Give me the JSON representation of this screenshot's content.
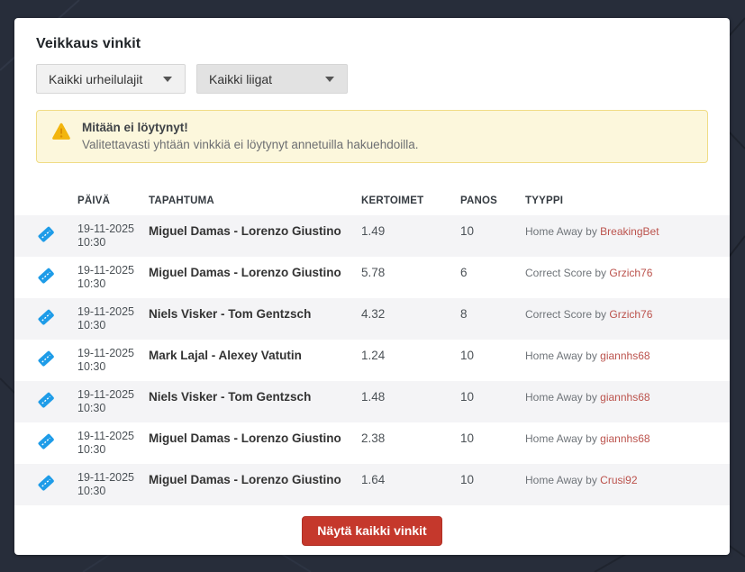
{
  "page": {
    "title": "Veikkaus vinkit"
  },
  "filters": {
    "sport": {
      "selected": "Kaikki urheilulajit"
    },
    "league": {
      "selected": "Kaikki liigat"
    }
  },
  "alert": {
    "icon": "warning-triangle-icon",
    "title": "Mitään ei löytynyt!",
    "message": "Valitettavasti yhtään vinkkiä ei löytynyt annetuilla hakuehdoilla."
  },
  "table": {
    "headers": [
      "PÄIVÄ",
      "TAPAHTUMA",
      "KERTOIMET",
      "PANOS",
      "TYYPPI"
    ],
    "row_icon": "ticket-icon",
    "rows": [
      {
        "date": "19-11-2025",
        "time": "10:30",
        "event": "Miguel Damas - Lorenzo Giustino",
        "odds": "1.49",
        "stake": "10",
        "type_prefix": "Home Away by",
        "tipster": "BreakingBet"
      },
      {
        "date": "19-11-2025",
        "time": "10:30",
        "event": "Miguel Damas - Lorenzo Giustino",
        "odds": "5.78",
        "stake": "6",
        "type_prefix": "Correct Score by",
        "tipster": "Grzich76"
      },
      {
        "date": "19-11-2025",
        "time": "10:30",
        "event": "Niels Visker - Tom Gentzsch",
        "odds": "4.32",
        "stake": "8",
        "type_prefix": "Correct Score by",
        "tipster": "Grzich76"
      },
      {
        "date": "19-11-2025",
        "time": "10:30",
        "event": "Mark Lajal - Alexey Vatutin",
        "odds": "1.24",
        "stake": "10",
        "type_prefix": "Home Away by",
        "tipster": "giannhs68"
      },
      {
        "date": "19-11-2025",
        "time": "10:30",
        "event": "Niels Visker - Tom Gentzsch",
        "odds": "1.48",
        "stake": "10",
        "type_prefix": "Home Away by",
        "tipster": "giannhs68"
      },
      {
        "date": "19-11-2025",
        "time": "10:30",
        "event": "Miguel Damas - Lorenzo Giustino",
        "odds": "2.38",
        "stake": "10",
        "type_prefix": "Home Away by",
        "tipster": "giannhs68"
      },
      {
        "date": "19-11-2025",
        "time": "10:30",
        "event": "Miguel Damas - Lorenzo Giustino",
        "odds": "1.64",
        "stake": "10",
        "type_prefix": "Home Away by",
        "tipster": "Crusi92"
      }
    ]
  },
  "footer": {
    "show_all_label": "Näytä kaikki vinkit"
  },
  "colors": {
    "page_bg": "#272d3a",
    "card_bg": "#ffffff",
    "zebra_row": "#f4f4f6",
    "ticket_blue": "#1e9ce8",
    "warning_yellow": "#f2b50e",
    "alert_bg": "#fcf7dc",
    "alert_border": "#f0dc85",
    "button_red": "#c5382c",
    "tipster_link_red": "#bb524c"
  }
}
